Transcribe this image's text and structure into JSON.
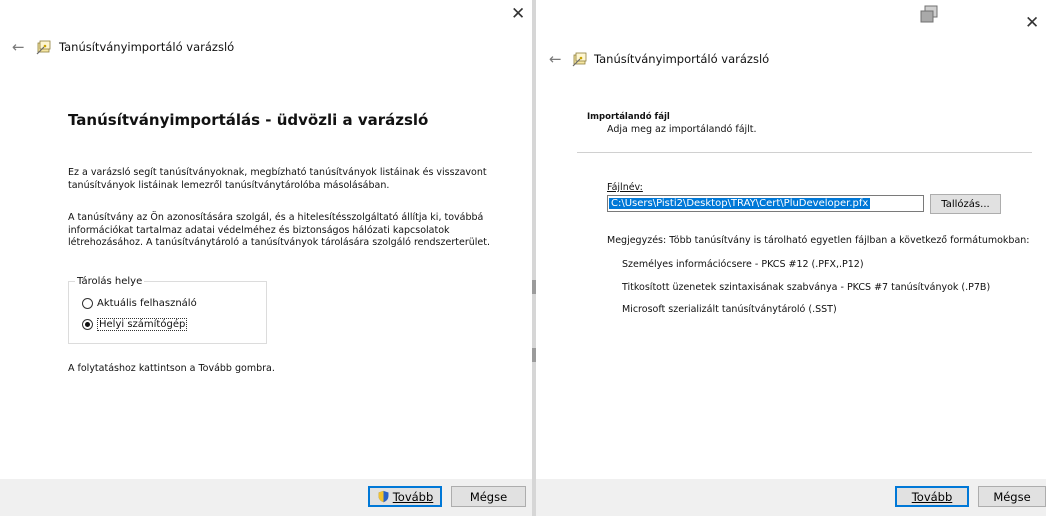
{
  "left": {
    "wizard_title": "Tanúsítványimportáló varázsló",
    "heading": "Tanúsítványimportálás - üdvözli a varázsló",
    "paragraph1": "Ez a varázsló segít tanúsítványoknak, megbízható tanúsítványok listáinak és visszavont tanúsítványok listáinak lemezről tanúsítványtárolóba másolásában.",
    "paragraph2": "A tanúsítvány az Ön azonosítására szolgál, és a hitelesítésszolgáltató állítja ki, továbbá információkat tartalmaz adatai védelméhez és biztonságos hálózati kapcsolatok létrehozásához. A tanúsítványtároló a tanúsítványok tárolására szolgáló rendszerterület.",
    "group_label": "Tárolás helye",
    "radio_current_user": "Aktuális felhasználó",
    "radio_local_machine": "Helyi számítógép",
    "selected_option": "Helyi számítógép",
    "continue_text": "A folytatáshoz kattintson a Tovább gombra.",
    "next_label": "Tovább",
    "cancel_label": "Mégse"
  },
  "right": {
    "wizard_title": "Tanúsítványimportáló varázsló",
    "section_title": "Importálandó fájl",
    "section_subtitle": "Adja meg az importálandó fájlt.",
    "filename_label": "Fájlnév:",
    "filename_value": "C:\\Users\\Pisti2\\Desktop\\TRAY\\Cert\\PluDeveloper.pfx",
    "browse_label": "Tallózás...",
    "note": "Megjegyzés: Több tanúsítvány is tárolható egyetlen fájlban a következő formátumokban:",
    "formats": [
      "Személyes információcsere - PKCS #12 (.PFX,.P12)",
      "Titkosított üzenetek szintaxisának szabványa  - PKCS #7 tanúsítványok (.P7B)",
      "Microsoft szerializált tanúsítványtároló (.SST)"
    ],
    "next_label": "Tovább",
    "cancel_label": "Mégse"
  },
  "icons": {
    "close": "close-icon",
    "back": "back-arrow-icon",
    "wizard": "certificate-wizard-icon",
    "shield": "uac-shield-icon",
    "window": "window-stack-icon"
  },
  "colors": {
    "selection": "#0078d7",
    "footer": "#f0f0f0",
    "button": "#e1e1e1"
  }
}
